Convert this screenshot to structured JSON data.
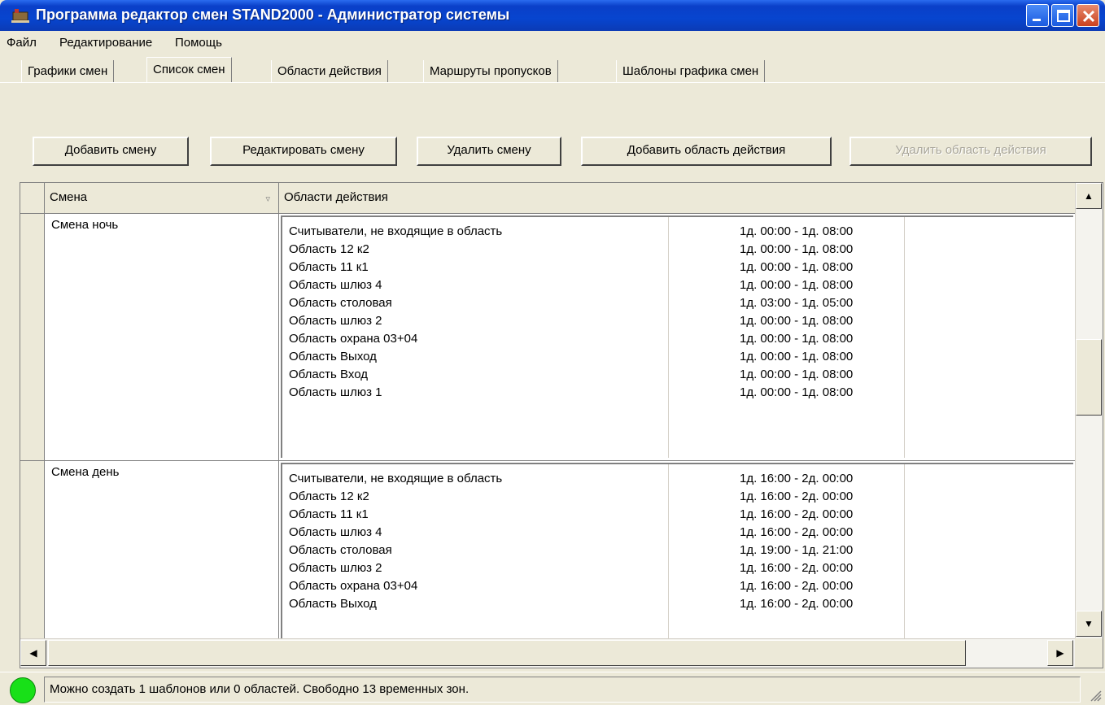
{
  "window": {
    "title": "Программа редактор смен STAND2000 - Администратор системы"
  },
  "menu": [
    "Файл",
    "Редактирование",
    "Помощь"
  ],
  "tabs": [
    {
      "label": "Графики смен",
      "active": false
    },
    {
      "label": "Список смен",
      "active": true
    },
    {
      "label": "Области действия",
      "active": false
    },
    {
      "label": "Маршруты пропусков",
      "active": false
    },
    {
      "label": "Шаблоны графика смен",
      "active": false
    }
  ],
  "toolbar": {
    "add_shift": "Добавить смену",
    "edit_shift": "Редактировать смену",
    "delete_shift": "Удалить смену",
    "add_area": "Добавить область действия",
    "delete_area": "Удалить область действия"
  },
  "grid": {
    "columns": [
      "Смена",
      "Области действия"
    ],
    "rows": [
      {
        "name": "Смена ночь",
        "areas": [
          {
            "name": "Считыватели, не входящие в область",
            "time": "1д. 00:00 - 1д. 08:00"
          },
          {
            "name": "Область 12 к2",
            "time": "1д. 00:00 - 1д. 08:00"
          },
          {
            "name": "Область 11 к1",
            "time": "1д. 00:00 - 1д. 08:00"
          },
          {
            "name": "Область шлюз 4",
            "time": "1д. 00:00 - 1д. 08:00"
          },
          {
            "name": "Область столовая",
            "time": "1д. 03:00 - 1д. 05:00"
          },
          {
            "name": "Область шлюз 2",
            "time": "1д. 00:00 - 1д. 08:00"
          },
          {
            "name": "Область охрана 03+04",
            "time": "1д. 00:00 - 1д. 08:00"
          },
          {
            "name": "Область Выход",
            "time": "1д. 00:00 - 1д. 08:00"
          },
          {
            "name": "Область Вход",
            "time": "1д. 00:00 - 1д. 08:00"
          },
          {
            "name": "Область шлюз 1",
            "time": "1д. 00:00 - 1д. 08:00"
          }
        ]
      },
      {
        "name": "Смена день",
        "areas": [
          {
            "name": "Считыватели, не входящие в область",
            "time": "1д. 16:00 - 2д. 00:00"
          },
          {
            "name": "Область 12 к2",
            "time": "1д. 16:00 - 2д. 00:00"
          },
          {
            "name": "Область 11 к1",
            "time": "1д. 16:00 - 2д. 00:00"
          },
          {
            "name": "Область шлюз 4",
            "time": "1д. 16:00 - 2д. 00:00"
          },
          {
            "name": "Область столовая",
            "time": "1д. 19:00 - 1д. 21:00"
          },
          {
            "name": "Область шлюз 2",
            "time": "1д. 16:00 - 2д. 00:00"
          },
          {
            "name": "Область охрана 03+04",
            "time": "1д. 16:00 - 2д. 00:00"
          },
          {
            "name": "Область Выход",
            "time": "1д. 16:00 - 2д. 00:00"
          }
        ]
      }
    ]
  },
  "status": {
    "text": "Можно создать 1 шаблонов или 0 областей. Свободно 13 временных зон.",
    "led_color": "#18e018"
  }
}
